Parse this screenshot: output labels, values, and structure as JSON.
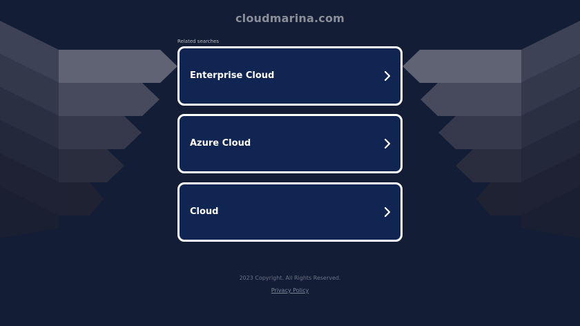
{
  "header": {
    "domain": "cloudmarina.com"
  },
  "related": {
    "label": "Related searches",
    "items": [
      {
        "label": "Enterprise Cloud",
        "icon": "chevron-right-icon"
      },
      {
        "label": "Azure Cloud",
        "icon": "chevron-right-icon"
      },
      {
        "label": "Cloud",
        "icon": "chevron-right-icon"
      }
    ]
  },
  "footer": {
    "copyright": "2023 Copyright. All Rights Reserved.",
    "privacy_label": "Privacy Policy"
  },
  "colors": {
    "background": "#131d35",
    "card_background": "#112552",
    "card_border": "#ffffff"
  }
}
